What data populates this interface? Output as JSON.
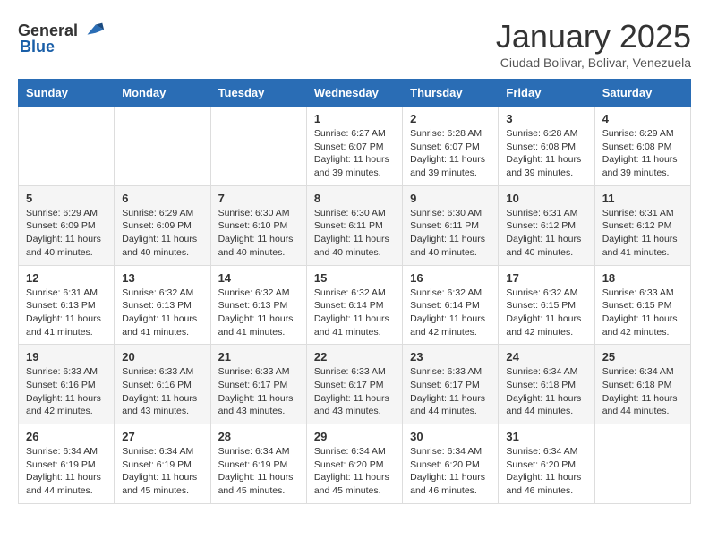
{
  "header": {
    "logo_general": "General",
    "logo_blue": "Blue",
    "month_title": "January 2025",
    "subtitle": "Ciudad Bolivar, Bolivar, Venezuela"
  },
  "weekdays": [
    "Sunday",
    "Monday",
    "Tuesday",
    "Wednesday",
    "Thursday",
    "Friday",
    "Saturday"
  ],
  "weeks": [
    [
      {
        "day": "",
        "info": ""
      },
      {
        "day": "",
        "info": ""
      },
      {
        "day": "",
        "info": ""
      },
      {
        "day": "1",
        "info": "Sunrise: 6:27 AM\nSunset: 6:07 PM\nDaylight: 11 hours and 39 minutes."
      },
      {
        "day": "2",
        "info": "Sunrise: 6:28 AM\nSunset: 6:07 PM\nDaylight: 11 hours and 39 minutes."
      },
      {
        "day": "3",
        "info": "Sunrise: 6:28 AM\nSunset: 6:08 PM\nDaylight: 11 hours and 39 minutes."
      },
      {
        "day": "4",
        "info": "Sunrise: 6:29 AM\nSunset: 6:08 PM\nDaylight: 11 hours and 39 minutes."
      }
    ],
    [
      {
        "day": "5",
        "info": "Sunrise: 6:29 AM\nSunset: 6:09 PM\nDaylight: 11 hours and 40 minutes."
      },
      {
        "day": "6",
        "info": "Sunrise: 6:29 AM\nSunset: 6:09 PM\nDaylight: 11 hours and 40 minutes."
      },
      {
        "day": "7",
        "info": "Sunrise: 6:30 AM\nSunset: 6:10 PM\nDaylight: 11 hours and 40 minutes."
      },
      {
        "day": "8",
        "info": "Sunrise: 6:30 AM\nSunset: 6:11 PM\nDaylight: 11 hours and 40 minutes."
      },
      {
        "day": "9",
        "info": "Sunrise: 6:30 AM\nSunset: 6:11 PM\nDaylight: 11 hours and 40 minutes."
      },
      {
        "day": "10",
        "info": "Sunrise: 6:31 AM\nSunset: 6:12 PM\nDaylight: 11 hours and 40 minutes."
      },
      {
        "day": "11",
        "info": "Sunrise: 6:31 AM\nSunset: 6:12 PM\nDaylight: 11 hours and 41 minutes."
      }
    ],
    [
      {
        "day": "12",
        "info": "Sunrise: 6:31 AM\nSunset: 6:13 PM\nDaylight: 11 hours and 41 minutes."
      },
      {
        "day": "13",
        "info": "Sunrise: 6:32 AM\nSunset: 6:13 PM\nDaylight: 11 hours and 41 minutes."
      },
      {
        "day": "14",
        "info": "Sunrise: 6:32 AM\nSunset: 6:13 PM\nDaylight: 11 hours and 41 minutes."
      },
      {
        "day": "15",
        "info": "Sunrise: 6:32 AM\nSunset: 6:14 PM\nDaylight: 11 hours and 41 minutes."
      },
      {
        "day": "16",
        "info": "Sunrise: 6:32 AM\nSunset: 6:14 PM\nDaylight: 11 hours and 42 minutes."
      },
      {
        "day": "17",
        "info": "Sunrise: 6:32 AM\nSunset: 6:15 PM\nDaylight: 11 hours and 42 minutes."
      },
      {
        "day": "18",
        "info": "Sunrise: 6:33 AM\nSunset: 6:15 PM\nDaylight: 11 hours and 42 minutes."
      }
    ],
    [
      {
        "day": "19",
        "info": "Sunrise: 6:33 AM\nSunset: 6:16 PM\nDaylight: 11 hours and 42 minutes."
      },
      {
        "day": "20",
        "info": "Sunrise: 6:33 AM\nSunset: 6:16 PM\nDaylight: 11 hours and 43 minutes."
      },
      {
        "day": "21",
        "info": "Sunrise: 6:33 AM\nSunset: 6:17 PM\nDaylight: 11 hours and 43 minutes."
      },
      {
        "day": "22",
        "info": "Sunrise: 6:33 AM\nSunset: 6:17 PM\nDaylight: 11 hours and 43 minutes."
      },
      {
        "day": "23",
        "info": "Sunrise: 6:33 AM\nSunset: 6:17 PM\nDaylight: 11 hours and 44 minutes."
      },
      {
        "day": "24",
        "info": "Sunrise: 6:34 AM\nSunset: 6:18 PM\nDaylight: 11 hours and 44 minutes."
      },
      {
        "day": "25",
        "info": "Sunrise: 6:34 AM\nSunset: 6:18 PM\nDaylight: 11 hours and 44 minutes."
      }
    ],
    [
      {
        "day": "26",
        "info": "Sunrise: 6:34 AM\nSunset: 6:19 PM\nDaylight: 11 hours and 44 minutes."
      },
      {
        "day": "27",
        "info": "Sunrise: 6:34 AM\nSunset: 6:19 PM\nDaylight: 11 hours and 45 minutes."
      },
      {
        "day": "28",
        "info": "Sunrise: 6:34 AM\nSunset: 6:19 PM\nDaylight: 11 hours and 45 minutes."
      },
      {
        "day": "29",
        "info": "Sunrise: 6:34 AM\nSunset: 6:20 PM\nDaylight: 11 hours and 45 minutes."
      },
      {
        "day": "30",
        "info": "Sunrise: 6:34 AM\nSunset: 6:20 PM\nDaylight: 11 hours and 46 minutes."
      },
      {
        "day": "31",
        "info": "Sunrise: 6:34 AM\nSunset: 6:20 PM\nDaylight: 11 hours and 46 minutes."
      },
      {
        "day": "",
        "info": ""
      }
    ]
  ]
}
